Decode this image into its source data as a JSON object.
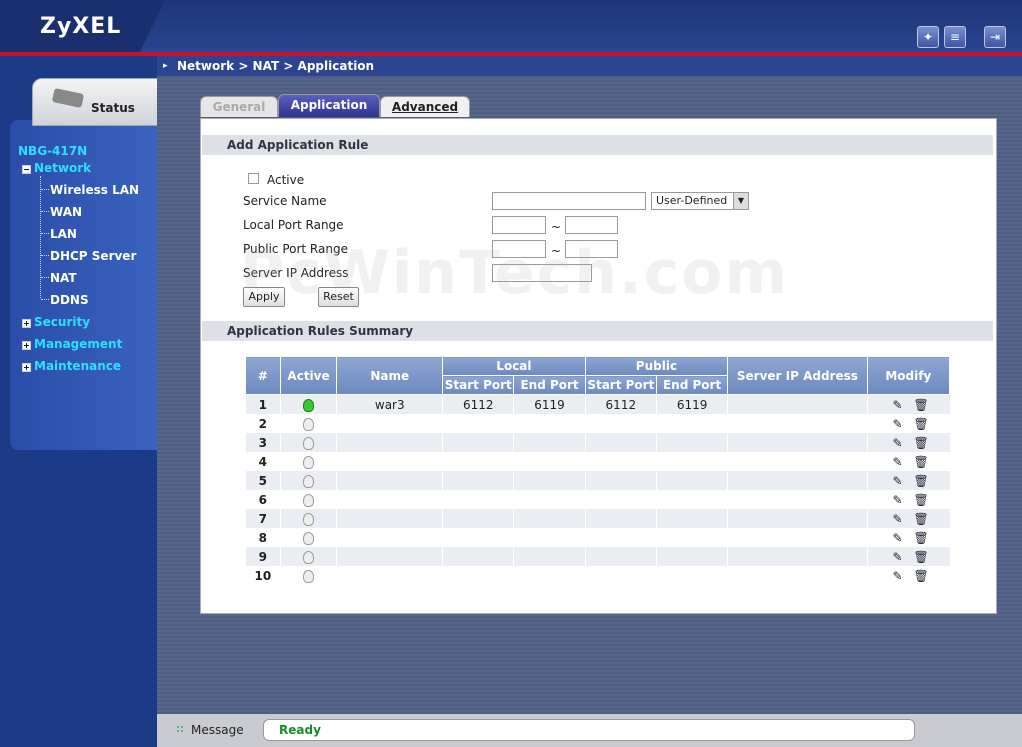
{
  "brand": {
    "logo": "ZyXEL",
    "model": "NBG-417N"
  },
  "header": {
    "icons": [
      "wizard-icon",
      "logout-help-icon",
      "logout-icon"
    ]
  },
  "sidebar": {
    "status_label": "Status",
    "network": "Network",
    "sub_items": [
      "Wireless LAN",
      "WAN",
      "LAN",
      "DHCP Server",
      "NAT",
      "DDNS"
    ],
    "security": "Security",
    "management": "Management",
    "maintenance": "Maintenance"
  },
  "breadcrumb": "Network > NAT > Application",
  "tabs": {
    "general": "General",
    "application": "Application",
    "advanced": "Advanced"
  },
  "add_rule": {
    "title": "Add Application Rule",
    "active_label": "Active",
    "service_name_label": "Service Name",
    "service_select": "User-Defined",
    "local_port_label": "Local Port Range",
    "public_port_label": "Public Port Range",
    "server_ip_label": "Server IP Address",
    "tilde": "~",
    "apply": "Apply",
    "reset": "Reset"
  },
  "summary": {
    "title": "Application Rules Summary",
    "headers": {
      "num": "#",
      "active": "Active",
      "name": "Name",
      "local": "Local",
      "public": "Public",
      "start_port": "Start Port",
      "end_port": "End Port",
      "server_ip": "Server IP Address",
      "modify": "Modify"
    },
    "rows": [
      {
        "num": "1",
        "active": true,
        "name": "war3",
        "ls": "6112",
        "le": "6119",
        "ps": "6112",
        "pe": "6119"
      },
      {
        "num": "2",
        "active": false,
        "name": "",
        "ls": "",
        "le": "",
        "ps": "",
        "pe": ""
      },
      {
        "num": "3",
        "active": false,
        "name": "",
        "ls": "",
        "le": "",
        "ps": "",
        "pe": ""
      },
      {
        "num": "4",
        "active": false,
        "name": "",
        "ls": "",
        "le": "",
        "ps": "",
        "pe": ""
      },
      {
        "num": "5",
        "active": false,
        "name": "",
        "ls": "",
        "le": "",
        "ps": "",
        "pe": ""
      },
      {
        "num": "6",
        "active": false,
        "name": "",
        "ls": "",
        "le": "",
        "ps": "",
        "pe": ""
      },
      {
        "num": "7",
        "active": false,
        "name": "",
        "ls": "",
        "le": "",
        "ps": "",
        "pe": ""
      },
      {
        "num": "8",
        "active": false,
        "name": "",
        "ls": "",
        "le": "",
        "ps": "",
        "pe": ""
      },
      {
        "num": "9",
        "active": false,
        "name": "",
        "ls": "",
        "le": "",
        "ps": "",
        "pe": ""
      },
      {
        "num": "10",
        "active": false,
        "name": "",
        "ls": "",
        "le": "",
        "ps": "",
        "pe": ""
      }
    ]
  },
  "message": {
    "label": "Message",
    "text": "Ready"
  },
  "watermark": "PcWinTech.com"
}
